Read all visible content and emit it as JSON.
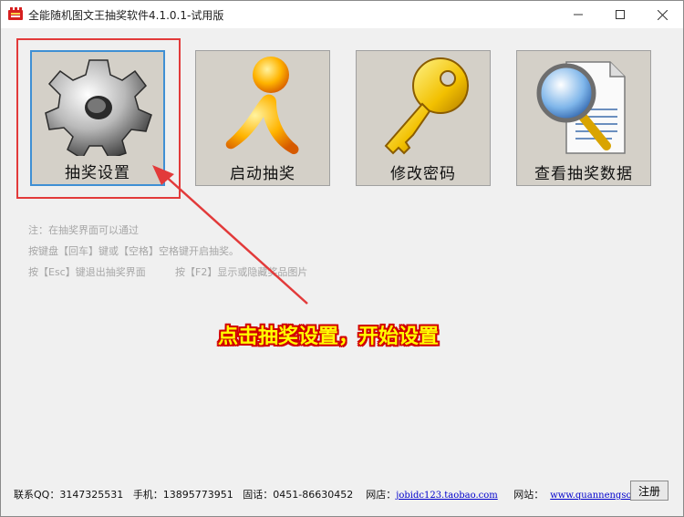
{
  "window": {
    "title": "全能随机图文王抽奖软件4.1.0.1-试用版"
  },
  "tiles": [
    {
      "label": "抽奖设置",
      "icon": "gear-icon"
    },
    {
      "label": "启动抽奖",
      "icon": "running-person-icon"
    },
    {
      "label": "修改密码",
      "icon": "key-icon"
    },
    {
      "label": "查看抽奖数据",
      "icon": "magnifier-document-icon"
    }
  ],
  "notes": {
    "line1": "注：在抽奖界面可以通过",
    "line2": "按键盘【回车】键或【空格】空格键开启抽奖。",
    "line3a": "按【Esc】键退出抽奖界面",
    "line3b": "按【F2】显示或隐藏奖品图片"
  },
  "callout": "点击抽奖设置，开始设置",
  "status": {
    "qq_label": "联系QQ：3147325531",
    "phone_label": "手机：13895773951",
    "tel_label": "固话：0451-86630452",
    "shop_label": "网店：",
    "shop_link": "jobidc123.taobao.com",
    "site_label": "网站：",
    "site_link": "www.quannengsoft.cn"
  },
  "register_button": "注册",
  "colors": {
    "highlight": "#e23a3a",
    "callout_text": "#ffff00",
    "callout_outline": "#d20000",
    "selected_border": "#3f8fd4",
    "link": "#0000cc"
  }
}
